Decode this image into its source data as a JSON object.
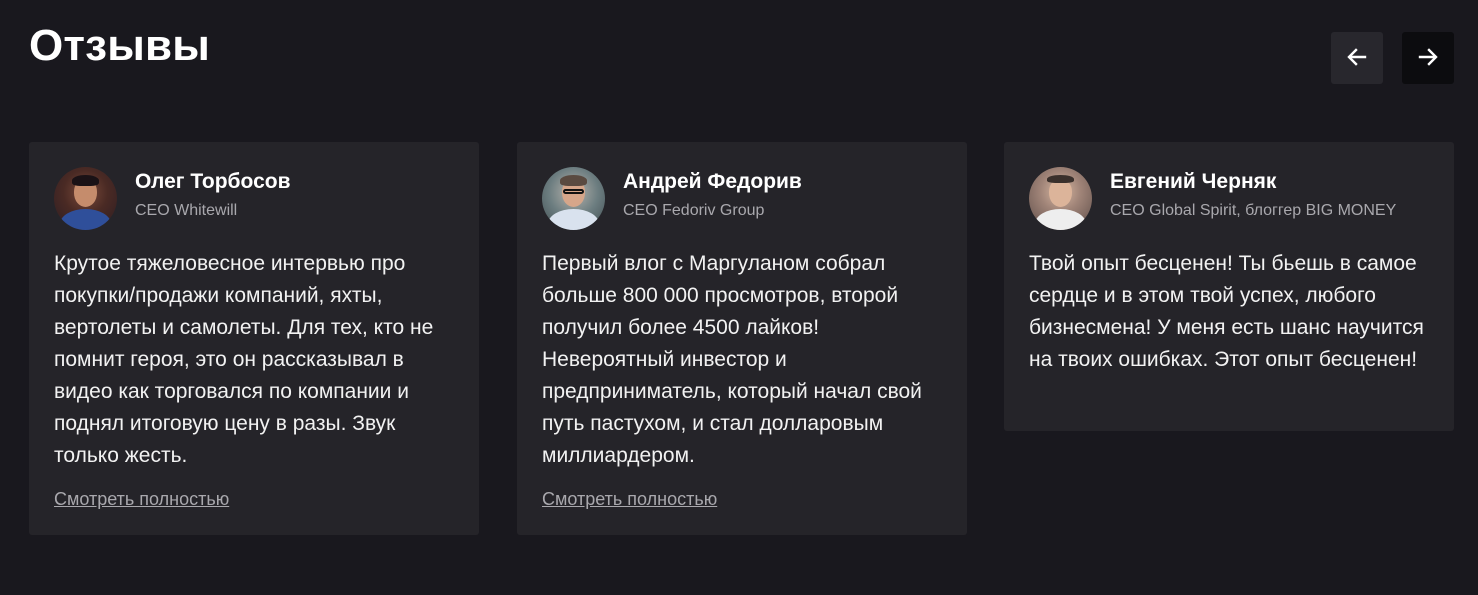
{
  "section": {
    "title": "Отзывы",
    "prev_icon": "arrow-left-icon",
    "next_icon": "arrow-right-icon"
  },
  "reviews": [
    {
      "name": "Олег Торбосов",
      "role": "CEO Whitewill",
      "text": "Крутое тяжеловесное интервью про покупки/продажи компаний, яхты, вертолеты и самолеты. Для тех, кто не помнит героя, это он рассказывал в видео как торговался по компании и поднял итоговую цену в разы. Звук только жесть.",
      "link": "Смотреть полностью"
    },
    {
      "name": "Андрей Федорив",
      "role": "CEO Fedoriv Group",
      "text": "Первый влог с Маргуланом собрал больше 800 000 просмотров, второй получил более 4500 лайков! Невероятный инвестор и предприниматель, который начал свой путь пастухом, и стал долларовым миллиардером.",
      "link": "Смотреть полностью"
    },
    {
      "name": "Евгений Черняк",
      "role": "CEO Global Spirit, блоггер BIG MONEY",
      "text": "Твой опыт бесценен! Ты бьешь в самое сердце и в этом твой успех, любого бизнесмена! У меня есть шанс научится на твоих ошибках. Этот опыт бесценен!"
    }
  ],
  "colors": {
    "background": "#19181e",
    "card": "#252429",
    "muted_text": "#a9a8ad"
  }
}
